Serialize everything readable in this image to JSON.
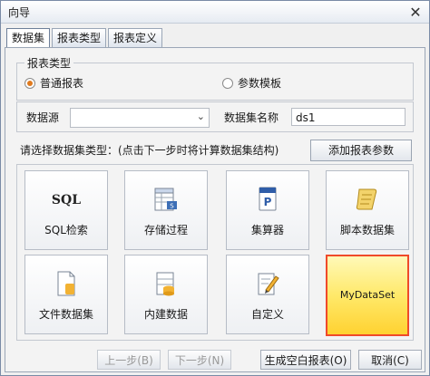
{
  "window": {
    "title": "向导",
    "close_glyph": "✕"
  },
  "tabs": [
    {
      "label": "数据集",
      "active": true
    },
    {
      "label": "报表类型",
      "active": false
    },
    {
      "label": "报表定义",
      "active": false
    }
  ],
  "report_type": {
    "legend": "报表类型",
    "options": [
      {
        "label": "普通报表",
        "checked": true
      },
      {
        "label": "参数模板",
        "checked": false
      }
    ]
  },
  "datasource": {
    "label": "数据源",
    "value": ""
  },
  "dataset_name": {
    "label": "数据集名称",
    "value": "ds1"
  },
  "prompt": "请选择数据集类型：(点击下一步时将计算数据集结构)",
  "add_param_button": "添加报表参数",
  "dataset_types": [
    {
      "label": "SQL检索",
      "icon": "sql-icon"
    },
    {
      "label": "存储过程",
      "icon": "stored-procedure-icon"
    },
    {
      "label": "集算器",
      "icon": "esproc-icon"
    },
    {
      "label": "脚本数据集",
      "icon": "script-scroll-icon"
    },
    {
      "label": "文件数据集",
      "icon": "file-icon"
    },
    {
      "label": "内建数据",
      "icon": "builtin-data-icon"
    },
    {
      "label": "自定义",
      "icon": "custom-pencil-icon"
    },
    {
      "label": "MyDataSet",
      "icon": "",
      "highlighted": true
    }
  ],
  "buttons": {
    "prev": "上一步(B)",
    "next": "下一步(N)",
    "blank": "生成空白报表(O)",
    "cancel": "取消(C)"
  },
  "colors": {
    "highlight_border": "#ef4a2a",
    "highlight_fill": "#ffe96a",
    "radio_accent": "#e07a1e"
  }
}
